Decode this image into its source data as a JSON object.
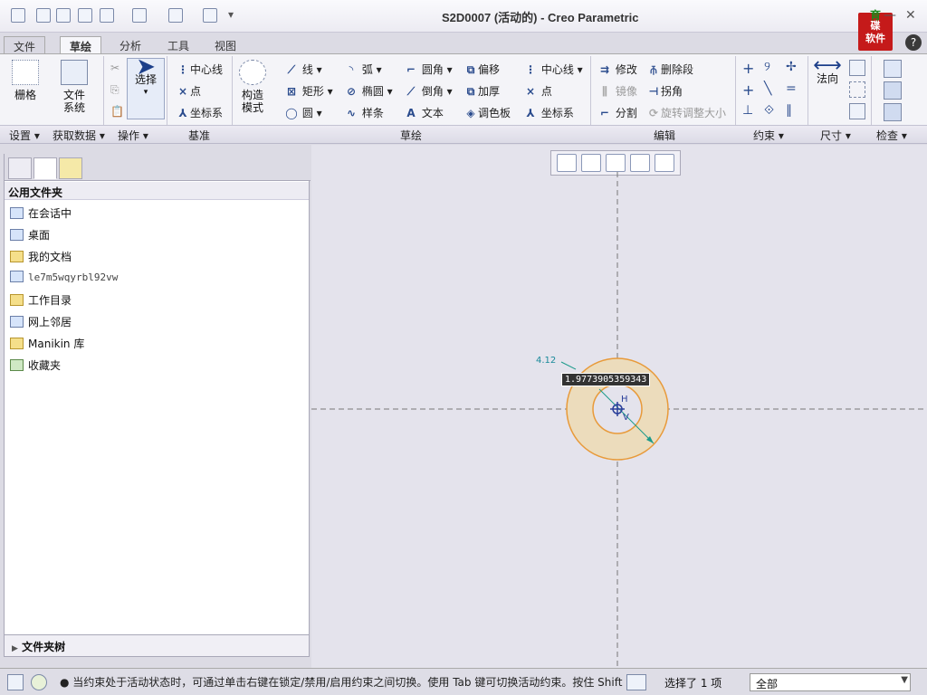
{
  "window": {
    "title": "S2D0007 (活动的) - Creo Parametric",
    "minimize": "—",
    "restore": "◻",
    "close": "✕",
    "help": "?"
  },
  "logo": {
    "line1": "育",
    "line2": "碟",
    "line3": "软件"
  },
  "menu_tabs": [
    "文件",
    "草绘",
    "分析",
    "工具",
    "视图"
  ],
  "ribbon": {
    "setup": {
      "grid": "栅格"
    },
    "get_data": {
      "file_system_line1": "文件",
      "file_system_line2": "系统"
    },
    "operations": {
      "select": "选择"
    },
    "datum": {
      "centerline": "中心线",
      "point": "点",
      "coord_sys": "坐标系"
    },
    "construction": {
      "line1": "构造",
      "line2": "模式"
    },
    "sketch": {
      "line": "线",
      "arc": "弧",
      "fillet": "圆角",
      "offset": "偏移",
      "rectangle": "矩形",
      "ellipse": "椭圆",
      "chamfer": "倒角",
      "thicken": "加厚",
      "circle": "圆",
      "spline": "样条",
      "text": "文本",
      "palette": "调色板",
      "centerline": "中心线",
      "point": "点",
      "coord_sys": "坐标系"
    },
    "edit": {
      "modify": "修改",
      "delete_segment": "删除段",
      "mirror": "镜像",
      "corner": "拐角",
      "divide": "分割",
      "rotate_resize": "旋转调整大小"
    },
    "dimension": {
      "normal": "法向"
    }
  },
  "groups": [
    "设置",
    "获取数据",
    "操作",
    "基准",
    "草绘",
    "编辑",
    "约束",
    "尺寸",
    "检查"
  ],
  "left_panel": {
    "header": "公用文件夹",
    "items": [
      "在会话中",
      "桌面",
      "我的文档",
      "le7m5wqyrbl92vw",
      "工作目录",
      "网上邻居",
      "Manikin 库",
      "收藏夹"
    ],
    "footer": "文件夹树"
  },
  "sketch": {
    "dimension_label": "4.12",
    "edit_value": "1.9773905359343",
    "constraint_h": "H",
    "constraint_v": "V",
    "ring_fill": "#ecdcbc",
    "ring_stroke": "#e89a3a"
  },
  "status": {
    "message": "● 当约束处于活动状态时，可通过单击右键在锁定/禁用/启用约束之间切换。使用 Tab 键可切换活动约束。按住 Shift",
    "selection": "选择了 1 项",
    "filter": "全部"
  }
}
